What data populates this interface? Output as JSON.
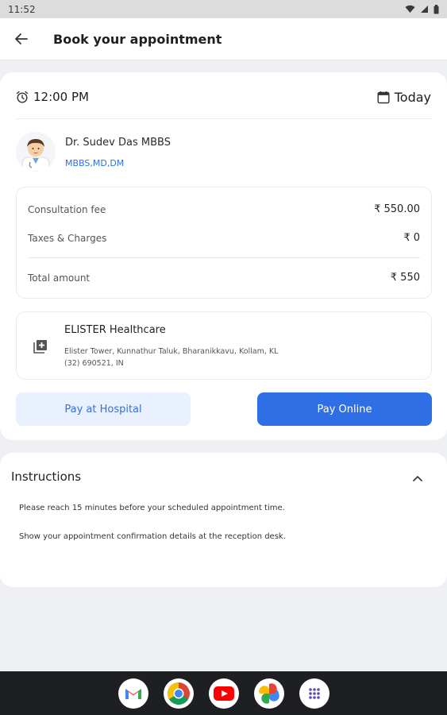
{
  "status_bar": {
    "time": "11:52"
  },
  "header": {
    "title": "Book your appointment"
  },
  "appointment": {
    "time": "12:00 PM",
    "date": "Today"
  },
  "doctor": {
    "name": "Dr. Sudev Das MBBS",
    "qualifications": "MBBS,MD,DM"
  },
  "fees": {
    "consultation_label": "Consultation fee",
    "consultation_value": "₹ 550.00",
    "taxes_label": "Taxes & Charges",
    "taxes_value": "₹ 0",
    "total_label": "Total amount",
    "total_value": "₹ 550"
  },
  "hospital": {
    "name": "ELISTER Healthcare",
    "address_line1": "Elister Tower, Kunnathur Taluk, Bharanikkavu, Kollam, KL",
    "address_line2": "(32) 690521, IN"
  },
  "buttons": {
    "pay_hospital": "Pay at Hospital",
    "pay_online": "Pay Online"
  },
  "instructions": {
    "title": "Instructions",
    "items": [
      "Please reach 15 minutes before your scheduled appointment time.",
      "Show your appointment confirmation details at the reception desk."
    ]
  },
  "dock": {
    "apps": [
      "gmail-icon",
      "chrome-icon",
      "youtube-icon",
      "photos-icon",
      "app-drawer-icon"
    ]
  },
  "colors": {
    "primary": "#2f6fe6",
    "primary_light": "#e8f1fd",
    "link": "#2f6fe4"
  }
}
